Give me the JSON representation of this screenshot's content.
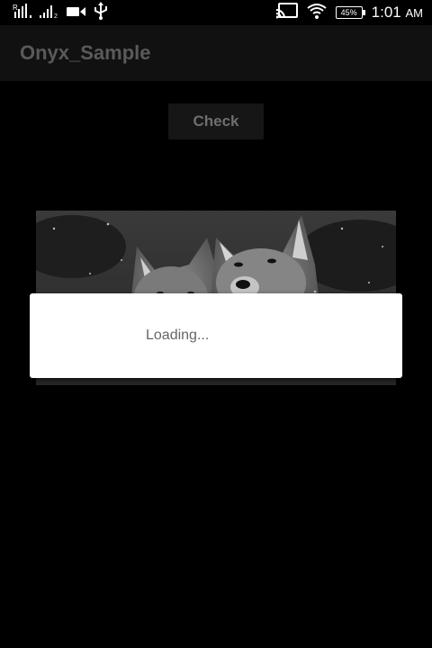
{
  "status_bar": {
    "time": "1:01",
    "ampm": "AM",
    "battery": "45%",
    "icons": [
      "signal-r-icon",
      "signal-2-icon",
      "video-camera-icon",
      "usb-icon",
      "cast-icon",
      "wifi-icon",
      "battery-icon"
    ]
  },
  "app": {
    "title": "Onyx_Sample"
  },
  "main": {
    "check_label": "Check",
    "image_subject": "two wolves in snow"
  },
  "dialog": {
    "message": "Loading..."
  }
}
